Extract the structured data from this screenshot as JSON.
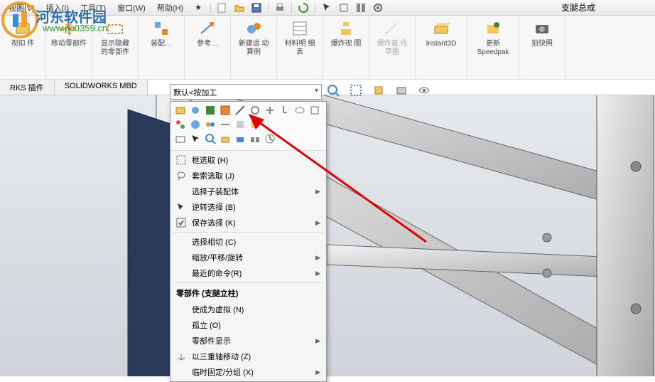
{
  "menubar": {
    "items": [
      "视图(V)",
      "插入(I)",
      "工具(T)",
      "窗口(W)",
      "帮助(H)",
      "★"
    ],
    "title": "支腿总成"
  },
  "ribbon": {
    "buttons": [
      {
        "label": "\n视扣\n件"
      },
      {
        "label": "移动零部件"
      },
      {
        "label": "显示隐藏\n的零部件"
      },
      {
        "label": "装配…"
      },
      {
        "label": "参考…"
      },
      {
        "label": "新建运\n动算例"
      },
      {
        "label": "材料明\n细表"
      },
      {
        "label": "爆炸视\n图"
      },
      {
        "label": "爆炸直\n线草图",
        "disabled": true
      },
      {
        "label": "Instant3D"
      },
      {
        "label": "更新\nSpeedpak"
      },
      {
        "label": "拍快照"
      }
    ]
  },
  "tabs": [
    "RKS 插件",
    "SOLIDWORKS MBD"
  ],
  "display_state": "默认<按加工",
  "context": {
    "section1": [
      {
        "label": "框选取 (H)",
        "icon": "box"
      },
      {
        "label": "套索选取 (J)",
        "icon": "lasso"
      },
      {
        "label": "选择子装配体",
        "icon": "",
        "sub": true
      },
      {
        "label": "逆转选择 (B)",
        "icon": "cursor"
      },
      {
        "label": "保存选择 (K)",
        "icon": "save",
        "sub": true
      }
    ],
    "section2": [
      {
        "label": "选择相切 (C)",
        "icon": ""
      },
      {
        "label": "缩放/平移/旋转",
        "icon": "",
        "sub": true
      },
      {
        "label": "最近的命令(R)",
        "icon": "",
        "sub": true
      }
    ],
    "header": "零部件 (支腿立柱)",
    "section3": [
      {
        "label": "使成为虚拟 (N)",
        "icon": ""
      },
      {
        "label": "孤立 (O)",
        "icon": ""
      },
      {
        "label": "零部件显示",
        "icon": "",
        "sub": true
      },
      {
        "label": "以三重轴移动 (Z)",
        "icon": "triad"
      },
      {
        "label": "临时固定/分组 (X)",
        "icon": ""
      }
    ]
  },
  "watermark": {
    "site": "河东软件园",
    "url": "www.pc0359.cn"
  }
}
